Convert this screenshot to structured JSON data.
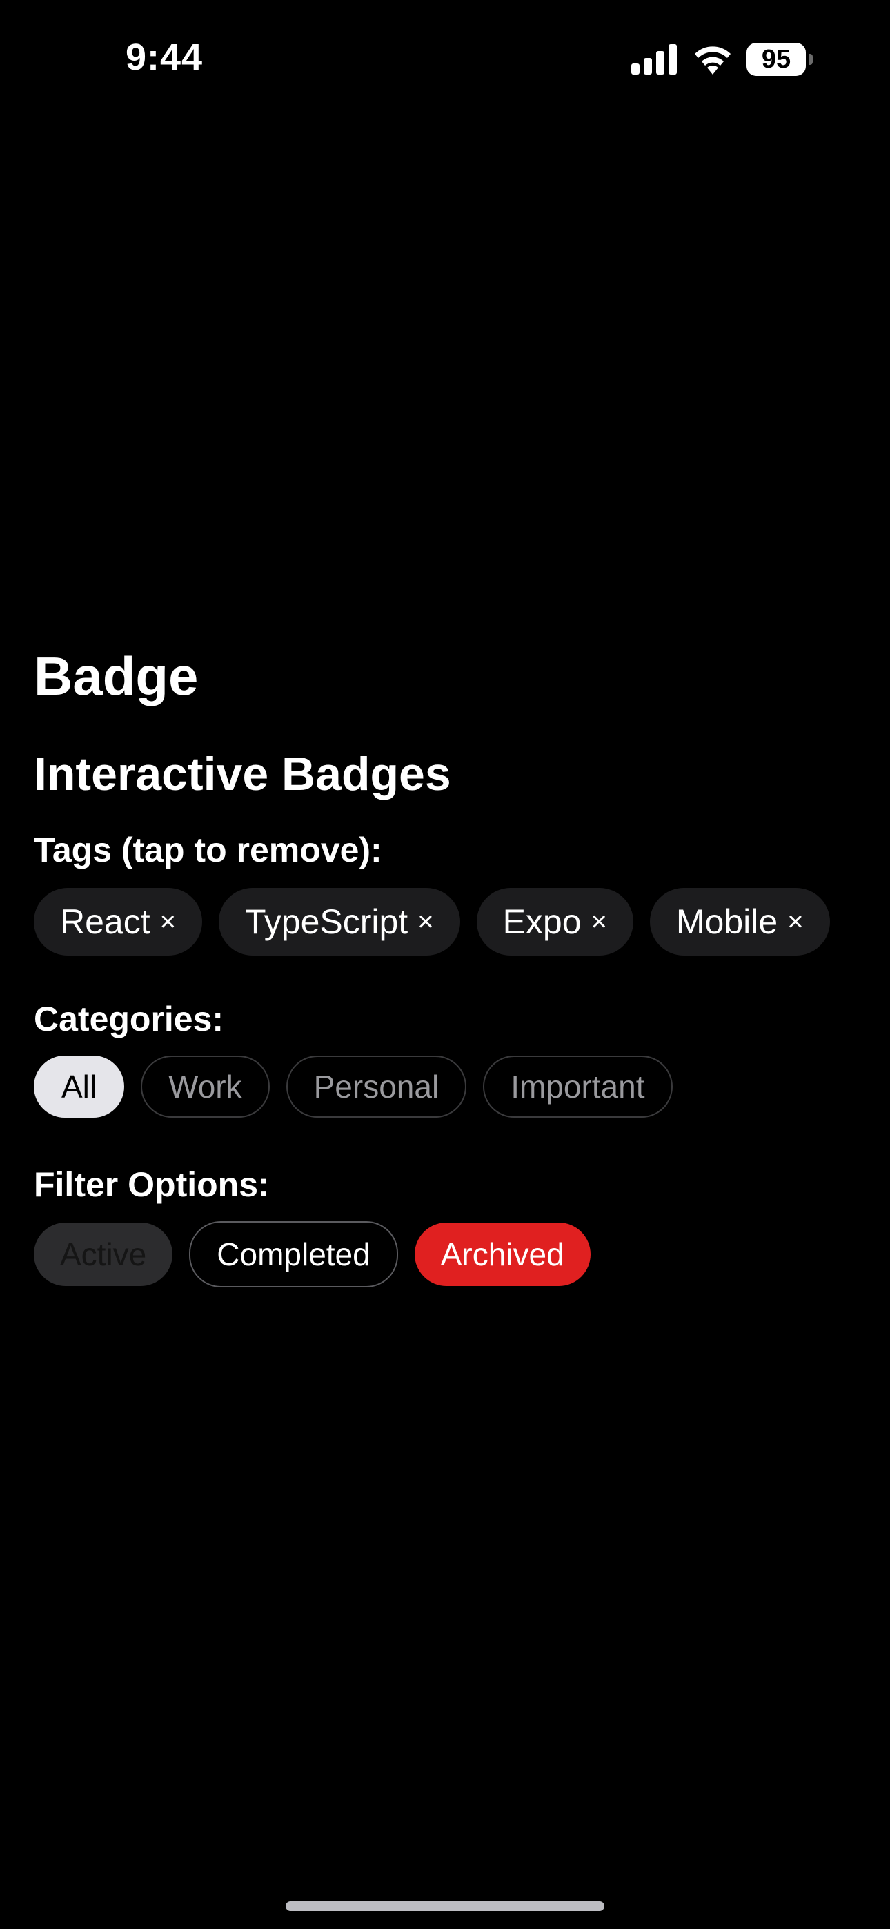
{
  "status_bar": {
    "time": "9:44",
    "battery_level": "95",
    "icons": [
      "signal-icon",
      "wifi-icon",
      "battery-icon"
    ]
  },
  "page": {
    "title": "Badge",
    "section_title": "Interactive Badges"
  },
  "tags": {
    "label": "Tags (tap to remove):",
    "remove_glyph": "×",
    "items": [
      {
        "label": "React"
      },
      {
        "label": "TypeScript"
      },
      {
        "label": "Expo"
      },
      {
        "label": "Mobile"
      }
    ]
  },
  "categories": {
    "label": "Categories:",
    "selected": "All",
    "items": [
      {
        "label": "All"
      },
      {
        "label": "Work"
      },
      {
        "label": "Personal"
      },
      {
        "label": "Important"
      }
    ]
  },
  "filters": {
    "label": "Filter Options:",
    "items": [
      {
        "label": "Active",
        "style": "muted"
      },
      {
        "label": "Completed",
        "style": "outline"
      },
      {
        "label": "Archived",
        "style": "danger"
      }
    ]
  },
  "colors": {
    "background": "#000000",
    "tag_chip": "#1c1c1e",
    "category_selected": "#e5e5ea",
    "danger": "#e02020"
  }
}
